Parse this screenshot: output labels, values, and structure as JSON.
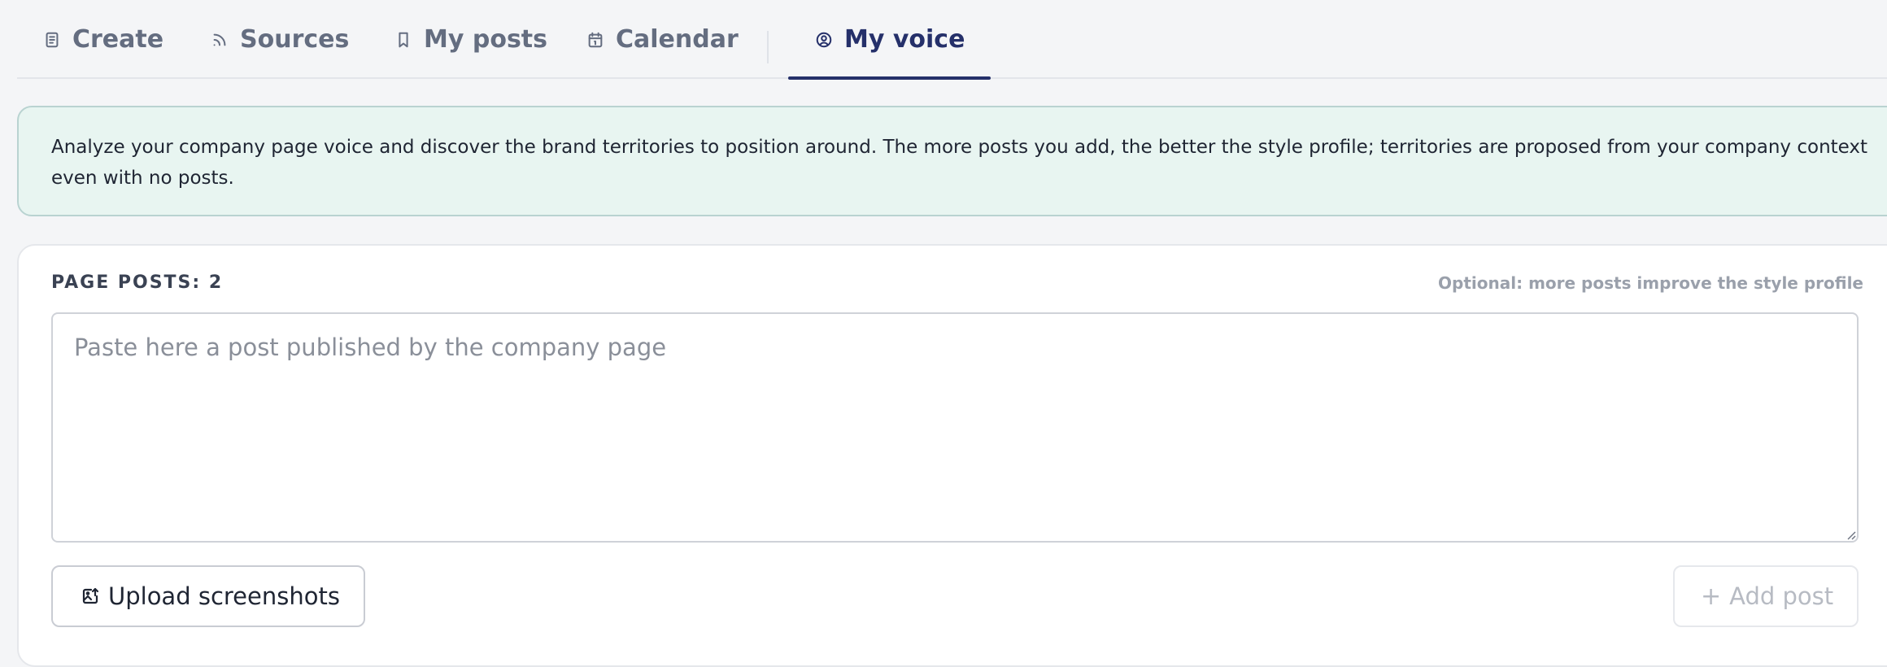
{
  "tabs": [
    {
      "label": "Create",
      "icon": "document-icon",
      "active": false
    },
    {
      "label": "Sources",
      "icon": "rss-icon",
      "active": false
    },
    {
      "label": "My posts",
      "icon": "bookmark-icon",
      "active": false
    },
    {
      "label": "Calendar",
      "icon": "calendar-icon",
      "active": false
    },
    {
      "label": "My voice",
      "icon": "user-circle-icon",
      "active": true
    }
  ],
  "info": {
    "text": "Analyze your company page voice and discover the brand territories to position around. The more posts you add, the better the style profile; territories are proposed from your company context even with no posts."
  },
  "posts": {
    "label": "PAGE POSTS: 2",
    "hint": "Optional: more posts improve the style profile",
    "placeholder": "Paste here a post published by the company page",
    "value": ""
  },
  "buttons": {
    "upload": "Upload screenshots",
    "add_plus": "+",
    "add": "Add post"
  },
  "colors": {
    "accent": "#25306a",
    "info_bg": "#e8f5f1",
    "page_bg": "#f4f5f7"
  }
}
